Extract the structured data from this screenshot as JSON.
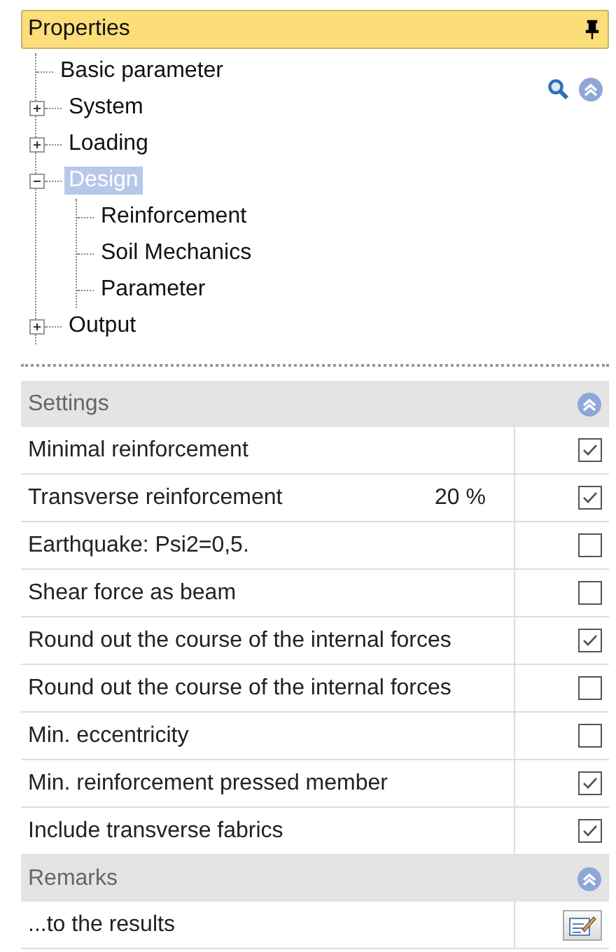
{
  "header": {
    "title": "Properties"
  },
  "tree": [
    {
      "label": "Basic parameter",
      "selected": false
    },
    {
      "label": "System",
      "expanded": false,
      "selected": false
    },
    {
      "label": "Loading",
      "expanded": false,
      "selected": false
    },
    {
      "label": "Design",
      "expanded": true,
      "selected": true,
      "children": [
        {
          "label": "Reinforcement",
          "selected": false
        },
        {
          "label": "Soil Mechanics",
          "selected": false
        },
        {
          "label": "Parameter",
          "selected": false
        }
      ]
    },
    {
      "label": "Output",
      "expanded": false,
      "selected": false
    }
  ],
  "settings": {
    "title": "Settings",
    "expanded": true,
    "rows": [
      {
        "label": "Minimal reinforcement",
        "checked": true
      },
      {
        "label": "Transverse reinforcement",
        "value": "20 %",
        "checked": true
      },
      {
        "label": "Earthquake: Psi2=0,5.",
        "checked": false
      },
      {
        "label": "Shear force as beam",
        "checked": false
      },
      {
        "label": "Round out the course of the internal forces",
        "checked": true
      },
      {
        "label": "Round out the course of the internal forces",
        "checked": false
      },
      {
        "label": "Min. eccentricity",
        "checked": false
      },
      {
        "label": "Min. reinforcement pressed member",
        "checked": true
      },
      {
        "label": "Include transverse fabrics",
        "checked": true
      }
    ]
  },
  "remarks": {
    "title": "Remarks",
    "expanded": true,
    "rows": [
      {
        "label": "...to the results"
      }
    ]
  }
}
